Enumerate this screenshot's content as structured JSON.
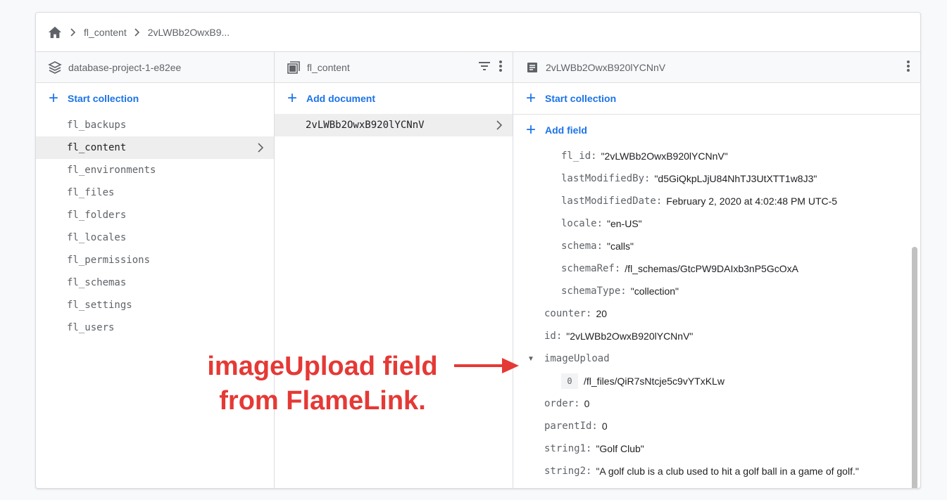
{
  "breadcrumb": {
    "items": [
      "fl_content",
      "2vLWBb2OwxB9..."
    ]
  },
  "panels": {
    "root": {
      "title": "database-project-1-e82ee",
      "start_collection": "Start collection",
      "collections": [
        "fl_backups",
        "fl_content",
        "fl_environments",
        "fl_files",
        "fl_folders",
        "fl_locales",
        "fl_permissions",
        "fl_schemas",
        "fl_settings",
        "fl_users"
      ]
    },
    "collection": {
      "title": "fl_content",
      "add_document": "Add document",
      "documents": [
        "2vLWBb2OwxB920lYCNnV"
      ]
    },
    "document": {
      "title": "2vLWBb2OwxB920lYCNnV",
      "start_collection": "Start collection",
      "add_field": "Add field",
      "fields": [
        {
          "key": "fl_id:",
          "value": "\"2vLWBb2OwxB920lYCNnV\""
        },
        {
          "key": "lastModifiedBy:",
          "value": "\"d5GiQkpLJjU84NhTJ3UtXTT1w8J3\""
        },
        {
          "key": "lastModifiedDate:",
          "value": "February 2, 2020 at 4:02:48 PM UTC-5"
        },
        {
          "key": "locale:",
          "value": "\"en-US\""
        },
        {
          "key": "schema:",
          "value": "\"calls\""
        },
        {
          "key": "schemaRef:",
          "value": "/fl_schemas/GtcPW9DAIxb3nP5GcOxA"
        },
        {
          "key": "schemaType:",
          "value": "\"collection\""
        },
        {
          "key": "counter:",
          "value": "20"
        },
        {
          "key": "id:",
          "value": "\"2vLWBb2OwxB920lYCNnV\""
        },
        {
          "key": "imageUpload",
          "value": ""
        },
        {
          "key": "0",
          "value": "/fl_files/QiR7sNtcje5c9vYTxKLw"
        },
        {
          "key": "order:",
          "value": "0"
        },
        {
          "key": "parentId:",
          "value": "0"
        },
        {
          "key": "string1:",
          "value": "\"Golf Club\""
        },
        {
          "key": "string2:",
          "value": "\"A golf club is a club used to hit a golf ball in a game of golf.\""
        }
      ]
    }
  },
  "annotation": {
    "line1": "imageUpload field",
    "line2": "from FlameLink.",
    "color": "#e53935"
  },
  "colors": {
    "accent": "#1a73e8",
    "selected_bg": "#eeeeee"
  }
}
